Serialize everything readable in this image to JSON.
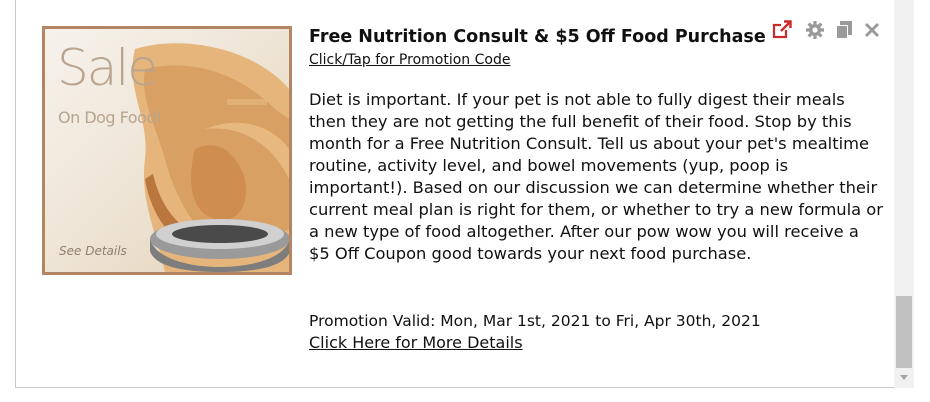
{
  "promo": {
    "image": {
      "sale_text": "Sale",
      "sub_text": "On Dog Food!",
      "see_details": "See Details",
      "border_color": "#b48562"
    },
    "title": "Free Nutrition Consult & $5 Off Food Purchase",
    "promo_code_link": "Click/Tap for Promotion Code",
    "description": "Diet is important. If your pet is not able to fully digest their meals then they are not getting the full benefit of their food. Stop by this month for a Free Nutrition Consult. Tell us about your pet's mealtime routine, activity level, and bowel movements (yup, poop is important!). Based on our discussion we can determine whether their current meal plan is right for them, or whether to try a new formula or a new type of food altogether. After our pow wow you will receive a $5 Off Coupon good towards your next food purchase.",
    "valid_text": "Promotion Valid: Mon, Mar 1st, 2021 to Fri, Apr 30th, 2021",
    "more_details_link": "Click Here for More Details"
  },
  "icons": [
    {
      "name": "external-link-icon",
      "color": "#cc2b2b"
    },
    {
      "name": "gear-icon",
      "color": "#9a9a9a"
    },
    {
      "name": "copy-icon",
      "color": "#9a9a9a"
    },
    {
      "name": "close-icon",
      "color": "#9a9a9a"
    }
  ]
}
